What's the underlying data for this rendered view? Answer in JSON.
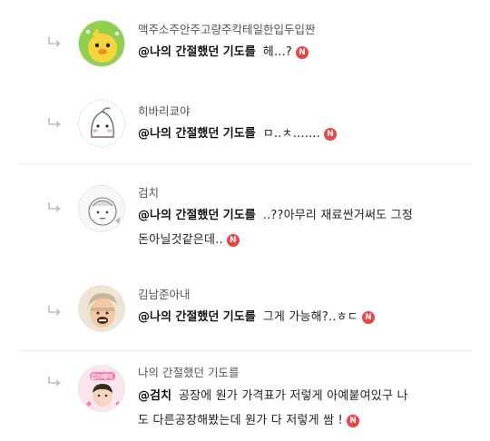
{
  "comments": [
    {
      "author": "맥주소주안주고량주칵테일한입두입짠",
      "mention": "@나의 간절했던 기도를",
      "text": "헤...?",
      "badge": "N",
      "avatar_icon": "yellow-character-avatar"
    },
    {
      "author": "히바리쿄야",
      "mention": "@나의 간절했던 기도를",
      "text": "ㅁ..ㅊ.......",
      "badge": "N",
      "avatar_icon": "white-character-avatar"
    },
    {
      "author": "검치",
      "mention": "@나의 간절했던 기도를",
      "text": "..??아무리 재료싼거써도 그정",
      "text_line2": "돈아닐것같은데..",
      "badge": "N",
      "avatar_icon": "sketch-character-avatar"
    },
    {
      "author": "김남준아내",
      "mention": "@나의 간절했던 기도를",
      "text": "그게 가능해?..ㅎㄷ",
      "badge": "N",
      "avatar_icon": "person-photo-avatar"
    },
    {
      "author": "나의 간절했던 기도를",
      "mention": "@검치",
      "text": "공장에 원가 가격표가 저렇게 아예붙여있구 나",
      "text_line2": "도 다른공장해봤는데 원가 다 저렇게 쌈 !",
      "badge": "N",
      "avatar_label": "겁쓰테이",
      "avatar_icon": "pink-sticker-avatar"
    }
  ],
  "colors": {
    "badge": "#f04343",
    "divider": "#ececec",
    "author_text": "#555555"
  }
}
